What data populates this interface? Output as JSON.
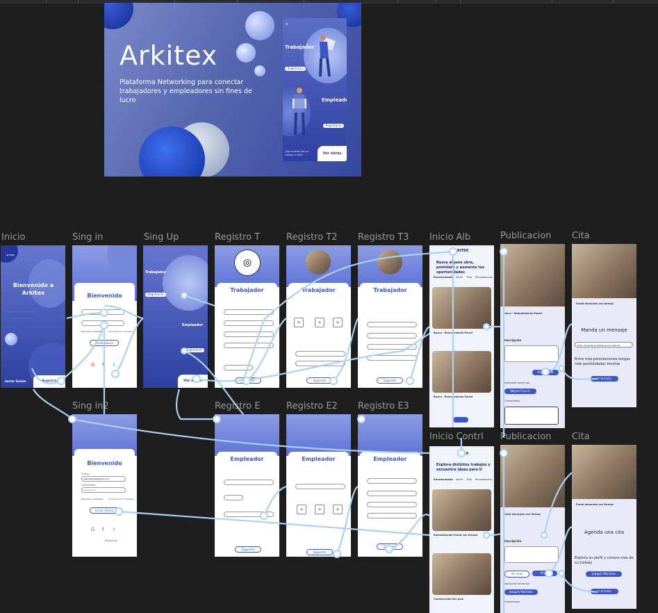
{
  "cover": {
    "title": "Arkitex",
    "subtitle": "Plataforma Networking para conectar trabajadores y empleadores sin fines de lucro",
    "phone": {
      "trabajador": "Trabajador",
      "empleador": "Empleador",
      "register": "Registrarse",
      "question": "¿Sos quieres dar un vistazo a esto?",
      "cta": "Ver obras"
    }
  },
  "frames": {
    "inicio": "Inicio",
    "sing_in": "Sing in",
    "sing_up": "Sing Up",
    "registro_t": "Registro T",
    "registro_t2": "Registro T2",
    "registro_t3": "Registro T3",
    "inicio_alb": "Inicio Alb",
    "publicacion_1": "Publicacion",
    "cita_1": "Cita",
    "sing_in2": "Sing in2",
    "registro_e": "Registro E",
    "registro_e2": "Registro E2",
    "registro_e3": "Registro E3",
    "inicio_contrl": "Inicio Contrl",
    "publicacion_2": "Publicacion",
    "cita_2": "Cita"
  },
  "inicio": {
    "logo": "arkitex",
    "welcome": "Bienvenido a Arkitex",
    "login": "Iniciar Sesión",
    "register": "Registrar"
  },
  "signin": {
    "title": "Bienvenido",
    "login_btn": "Iniciar Sesion",
    "remember": "Recordar contraseña",
    "forgot": "¿Olvidaste la contraseña?",
    "email_label": "Correo",
    "email_value": "joaksuel123@gmail.com",
    "password_label": "Contraseña",
    "password_value": "••••••••••",
    "register_link": "Registrate"
  },
  "signup": {
    "trabajador": "Trabajador",
    "empleador": "Empleador",
    "register": "Registrarse",
    "cta": "Ver obras"
  },
  "registro": {
    "trabajador": "Trabajador",
    "empleador": "Empleador",
    "next": "Siguiente"
  },
  "feed": {
    "brand": "KITEX",
    "headline_alb": "Busca alguna obra, postúlate y aumenta tus oportunidades",
    "headline_contrl": "Explora distintos trabajos y encuentra ideas para ti",
    "tabs": [
      "Recomendado",
      "Pared",
      "Piso",
      "Remodelacion"
    ],
    "post1": "Busco - Remodelación Pared",
    "post2": "Busco - Remodelación Pared",
    "post3": "Remodelación Pared con formas",
    "post4": "Construcción Ser plus"
  },
  "publicacion": {
    "title_1": "Busco - Remodelación Pared",
    "title_2": "Pared decorada con formas",
    "description_label": "Descripción",
    "apply": "Postularme",
    "published_by": "Publicación hecha por",
    "author_1": "Miguel Cruz H.",
    "author_2": "Joaquín Martínez",
    "comments": "Comentarios",
    "view_more": "Ver mas",
    "add": "Añadir"
  },
  "cita": {
    "item": "Pared decorada con formas",
    "message_title": "Manda un mensaje",
    "message_placeholder": "Hola, me gusta tu trabajo quiero algo así",
    "note": "Entre más postulaciones tengas más posibilidades tendrás",
    "go_home": "Ir al inicio",
    "appointment_title": "Agenda una cita",
    "explore_note": "Explora su perfil y conoce más de su trabajo",
    "author": "Joaquín Martínez"
  },
  "colors": {
    "canvas": "#1e1e1e",
    "brand_blue": "#3d57c9",
    "flow_line": "#a9d2f5"
  }
}
